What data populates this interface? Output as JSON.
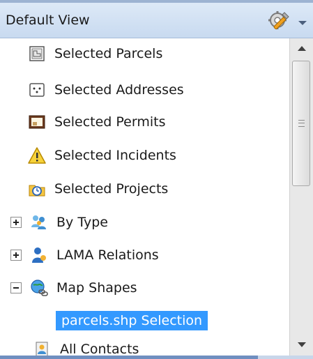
{
  "header": {
    "title": "Default View",
    "settings_icon": "wrench-gear-icon",
    "dropdown_icon": "chevron-down-icon"
  },
  "tree": {
    "items": [
      {
        "label": "Selected Parcels",
        "icon": "parcel-icon"
      },
      {
        "label": "Selected Addresses",
        "icon": "address-icon"
      },
      {
        "label": "Selected Permits",
        "icon": "permit-icon"
      },
      {
        "label": "Selected Incidents",
        "icon": "warning-icon"
      },
      {
        "label": "Selected Projects",
        "icon": "project-icon"
      },
      {
        "label": "By Type",
        "icon": "people-group-icon",
        "expander": "plus"
      },
      {
        "label": "LAMA Relations",
        "icon": "person-icon",
        "expander": "plus"
      },
      {
        "label": "Map Shapes",
        "icon": "globe-link-icon",
        "expander": "minus"
      },
      {
        "label": "parcels.shp Selection",
        "selected": true
      },
      {
        "label": "All Contacts",
        "icon": "contacts-icon"
      }
    ]
  },
  "colors": {
    "selection": "#3399ff",
    "header_bg": "#d6e4f5"
  }
}
